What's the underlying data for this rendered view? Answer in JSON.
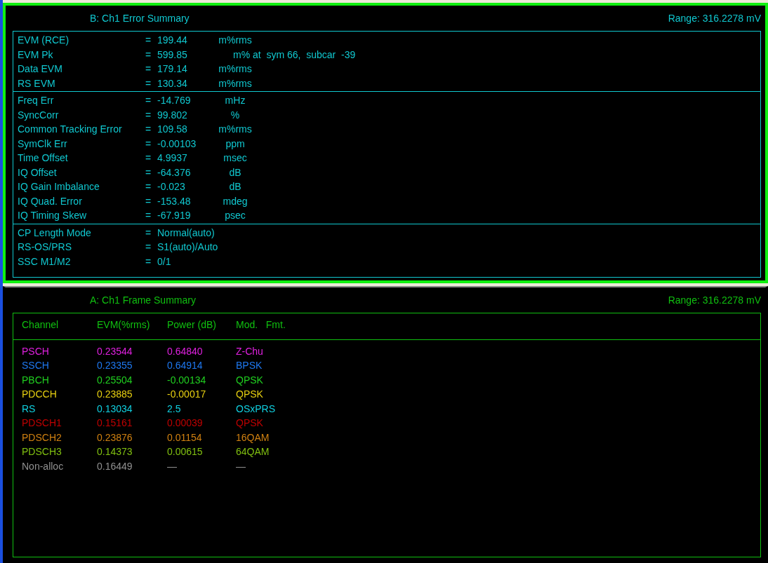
{
  "panels": [
    {
      "kind": "error_summary",
      "title": "B: Ch1 Error Summary",
      "range": "Range: 316.2278 mV",
      "selected": true,
      "groups": [
        [
          {
            "label": "EVM (RCE)",
            "eq": "=",
            "value": "199.44",
            "unit": "m%rms"
          },
          {
            "label": "EVM Pk",
            "eq": "=",
            "value": "599.85",
            "unit": "m% at  sym 66,  subcar  -39",
            "kind": "peak"
          },
          {
            "label": "Data EVM",
            "eq": "=",
            "value": "179.14",
            "unit": "m%rms"
          },
          {
            "label": "RS EVM",
            "eq": "=",
            "value": "130.34",
            "unit": "m%rms"
          }
        ],
        [
          {
            "label": "Freq Err",
            "eq": "=",
            "value": "-14.769",
            "unit": "mHz"
          },
          {
            "label": "SyncCorr",
            "eq": "=",
            "value": "99.802",
            "unit": "%"
          },
          {
            "label": "Common Tracking Error",
            "eq": "=",
            "value": "109.58",
            "unit": "m%rms"
          },
          {
            "label": "SymClk Err",
            "eq": "=",
            "value": "-0.00103",
            "unit": "ppm"
          },
          {
            "label": "Time Offset",
            "eq": "=",
            "value": "4.9937",
            "unit": "msec"
          },
          {
            "label": "IQ Offset",
            "eq": "=",
            "value": "-64.376",
            "unit": "dB"
          },
          {
            "label": "IQ Gain Imbalance",
            "eq": "=",
            "value": "-0.023",
            "unit": "dB"
          },
          {
            "label": "IQ Quad. Error",
            "eq": "=",
            "value": "-153.48",
            "unit": "mdeg"
          },
          {
            "label": "IQ Timing Skew",
            "eq": "=",
            "value": "-67.919",
            "unit": "psec"
          }
        ],
        [
          {
            "label": "CP Length Mode",
            "eq": "=",
            "value": "Normal(auto)"
          },
          {
            "label": "RS-OS/PRS",
            "eq": "=",
            "value": "S1(auto)/Auto"
          },
          {
            "label": "SSC M1/M2",
            "eq": "=",
            "value": "0/1"
          }
        ]
      ]
    },
    {
      "kind": "frame_summary",
      "title": "A: Ch1 Frame Summary",
      "range": "Range: 316.2278 mV",
      "selected": false,
      "columns": [
        "Channel",
        "EVM(%rms)",
        "Power (dB)",
        "Mod.   Fmt."
      ],
      "rows": [
        {
          "cells": [
            "PSCH",
            "0.23544",
            "0.64840",
            "Z-Chu"
          ],
          "color": "#e020e0"
        },
        {
          "cells": [
            "SSCH",
            "0.23355",
            "0.64914",
            "BPSK"
          ],
          "color": "#1e78f0"
        },
        {
          "cells": [
            "PBCH",
            "0.25504",
            "-0.00134",
            "QPSK"
          ],
          "color": "#20d020"
        },
        {
          "cells": [
            "PDCCH",
            "0.23885",
            "-0.00017",
            "QPSK"
          ],
          "color": "#e8d010"
        },
        {
          "cells": [
            "RS",
            "0.13034",
            "2.5",
            "OSxPRS"
          ],
          "color": "#10d0e0"
        },
        {
          "cells": [
            "PDSCH1",
            "0.15161",
            "0.00039",
            "QPSK"
          ],
          "color": "#c00000"
        },
        {
          "cells": [
            "PDSCH2",
            "0.23876",
            "0.01154",
            "16QAM"
          ],
          "color": "#d08010"
        },
        {
          "cells": [
            "PDSCH3",
            "0.14373",
            "0.00615",
            "64QAM"
          ],
          "color": "#80c010"
        },
        {
          "cells": [
            "Non-alloc",
            "0.16449",
            "—",
            "—"
          ],
          "color": "#909090"
        }
      ]
    }
  ]
}
